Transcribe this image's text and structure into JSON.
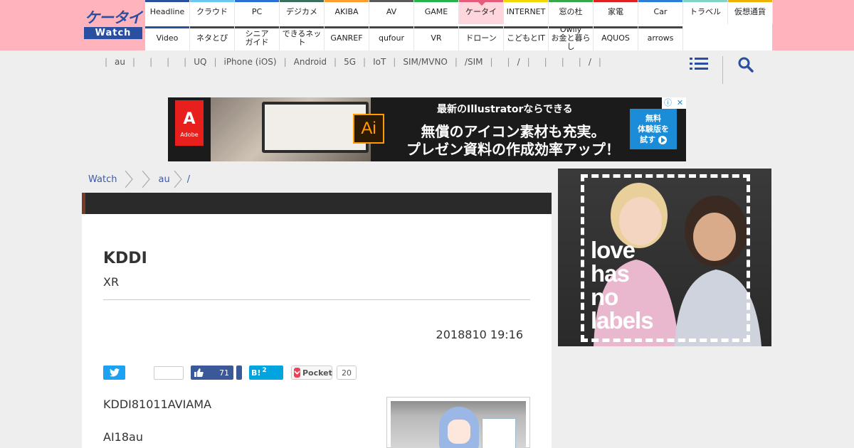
{
  "logo": {
    "top": "ケータイ",
    "bottom": "Watch"
  },
  "nav": {
    "row1": [
      {
        "label": "Headline",
        "color": "#2a4ea0"
      },
      {
        "label": "クラウド",
        "color": "#6cc8f0"
      },
      {
        "label": "PC",
        "color": "#2a6fd8"
      },
      {
        "label": "デジカメ",
        "color": "#3a6e5f"
      },
      {
        "label": "AKIBA",
        "color": "#ff9e2c"
      },
      {
        "label": "AV",
        "color": "#5a5a5a"
      },
      {
        "label": "GAME",
        "color": "#26b34a"
      },
      {
        "label": "ケータイ",
        "color": "#e65a7a"
      },
      {
        "label": "INTERNET",
        "color": "#f3d700"
      },
      {
        "label": "窓の杜",
        "color": "#37a84a"
      },
      {
        "label": "家電",
        "color": "#e02020"
      },
      {
        "label": "Car",
        "color": "#2d7ed9"
      },
      {
        "label": "トラベル",
        "color": "#7fd6c6"
      },
      {
        "label": "仮想通貨",
        "color": "#f0b200"
      }
    ],
    "row2": [
      {
        "label": "Video",
        "color": "#2a4ea0"
      },
      {
        "label": "ネタとぴ",
        "color": "#444444"
      },
      {
        "label": "シニア\nガイド",
        "color": "#444444"
      },
      {
        "label": "できるネット",
        "color": "#444444"
      },
      {
        "label": "GANREF",
        "color": "#444444"
      },
      {
        "label": "qufour",
        "color": "#444444"
      },
      {
        "label": "VR",
        "color": "#444444"
      },
      {
        "label": "ドローン",
        "color": "#444444"
      },
      {
        "label": "こどもとIT",
        "color": "#444444"
      },
      {
        "label": "Owlly\nお金と暮らし",
        "color": "#444444"
      },
      {
        "label": "AQUOS",
        "color": "#444444"
      },
      {
        "label": "arrows",
        "color": "#444444"
      }
    ],
    "active": "ケータイ"
  },
  "subnav": {
    "items": [
      "",
      "au",
      "",
      "",
      "",
      "UQ",
      "iPhone (iOS)",
      "Android",
      "5G",
      "IoT",
      "SIM/MVNO",
      "/SIM",
      "",
      "/",
      "",
      "",
      "",
      "/",
      ""
    ]
  },
  "icons": {
    "menu": "menu-icon",
    "search": "search-icon"
  },
  "ad": {
    "brand": "Adobe",
    "brand_letter": "A",
    "app_icon": "Ai",
    "line1": "最新のIllustratorならできる",
    "line2": "無償のアイコン素材も充実。",
    "line3": "プレゼン資料の作成効率アップ！",
    "cta": "無料\n体験版を\n試す",
    "adchoice": "ⓘ",
    "close": "✕"
  },
  "breadcrumb": [
    "Watch",
    "au",
    "/"
  ],
  "article": {
    "title": "KDDI",
    "subtitle": "XR",
    "date": "2018810 19:16",
    "body1": "KDDI81011AVIAMA",
    "body2": "AI18au"
  },
  "share": {
    "facebook_count": "71",
    "hatena_label": "B!",
    "hatena_count": "2",
    "pocket_label": "Pocket",
    "pocket_count": "20"
  },
  "side_ad": {
    "words": [
      "love",
      "has",
      "no",
      "labels"
    ]
  },
  "colors": {
    "header_bg": "#ffb3bd",
    "brand_blue": "#2a4ea0",
    "link": "#3c5aa6",
    "twitter": "#1da1f2",
    "facebook": "#3b5998",
    "hatena": "#00a4de",
    "pocket": "#ef4056"
  }
}
